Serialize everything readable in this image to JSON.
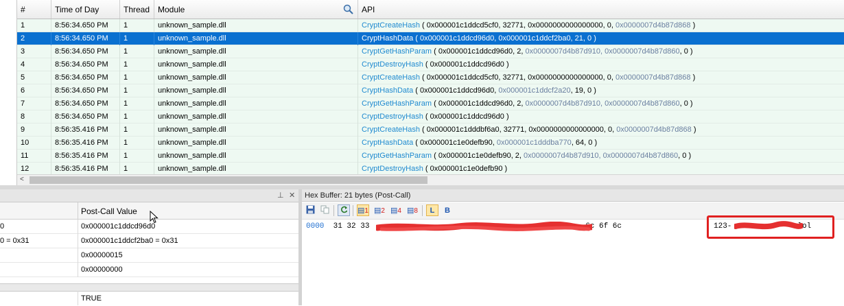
{
  "grid": {
    "columns": [
      "#",
      "Time of Day",
      "Thread",
      "Module",
      "API"
    ],
    "rows": [
      {
        "n": "1",
        "time": "8:56:34.650 PM",
        "thread": "1",
        "module": "unknown_sample.dll",
        "fn": "CryptCreateHash",
        "pre": " ( 0x000001c1ddcd5cf0, 32771, 0x0000000000000000, 0, ",
        "ptr": "0x0000007d4b87d868",
        "post": " )"
      },
      {
        "n": "2",
        "time": "8:56:34.650 PM",
        "thread": "1",
        "module": "unknown_sample.dll",
        "fn": "CryptHashData",
        "pre": " ( 0x000001c1ddcd96d0, 0x000001c1ddcf2ba0, 21, 0 )",
        "ptr": "",
        "post": ""
      },
      {
        "n": "3",
        "time": "8:56:34.650 PM",
        "thread": "1",
        "module": "unknown_sample.dll",
        "fn": "CryptGetHashParam",
        "pre": " ( 0x000001c1ddcd96d0, 2, ",
        "ptr": "0x0000007d4b87d910, 0x0000007d4b87d860",
        "post": ", 0 )"
      },
      {
        "n": "4",
        "time": "8:56:34.650 PM",
        "thread": "1",
        "module": "unknown_sample.dll",
        "fn": "CryptDestroyHash",
        "pre": " ( 0x000001c1ddcd96d0 )",
        "ptr": "",
        "post": ""
      },
      {
        "n": "5",
        "time": "8:56:34.650 PM",
        "thread": "1",
        "module": "unknown_sample.dll",
        "fn": "CryptCreateHash",
        "pre": " ( 0x000001c1ddcd5cf0, 32771, 0x0000000000000000, 0, ",
        "ptr": "0x0000007d4b87d868",
        "post": " )"
      },
      {
        "n": "6",
        "time": "8:56:34.650 PM",
        "thread": "1",
        "module": "unknown_sample.dll",
        "fn": "CryptHashData",
        "pre": " ( 0x000001c1ddcd96d0, ",
        "ptr": "0x000001c1ddcf2a20",
        "post": ", 19, 0 )"
      },
      {
        "n": "7",
        "time": "8:56:34.650 PM",
        "thread": "1",
        "module": "unknown_sample.dll",
        "fn": "CryptGetHashParam",
        "pre": " ( 0x000001c1ddcd96d0, 2, ",
        "ptr": "0x0000007d4b87d910, 0x0000007d4b87d860",
        "post": ", 0 )"
      },
      {
        "n": "8",
        "time": "8:56:34.650 PM",
        "thread": "1",
        "module": "unknown_sample.dll",
        "fn": "CryptDestroyHash",
        "pre": " ( 0x000001c1ddcd96d0 )",
        "ptr": "",
        "post": ""
      },
      {
        "n": "9",
        "time": "8:56:35.416 PM",
        "thread": "1",
        "module": "unknown_sample.dll",
        "fn": "CryptCreateHash",
        "pre": " ( 0x000001c1dddbf6a0, 32771, 0x0000000000000000, 0, ",
        "ptr": "0x0000007d4b87d868",
        "post": " )"
      },
      {
        "n": "10",
        "time": "8:56:35.416 PM",
        "thread": "1",
        "module": "unknown_sample.dll",
        "fn": "CryptHashData",
        "pre": " ( 0x000001c1e0defb90, ",
        "ptr": "0x000001c1dddba770",
        "post": ", 64, 0 )"
      },
      {
        "n": "11",
        "time": "8:56:35.416 PM",
        "thread": "1",
        "module": "unknown_sample.dll",
        "fn": "CryptGetHashParam",
        "pre": " ( 0x000001c1e0defb90, 2, ",
        "ptr": "0x0000007d4b87d910, 0x0000007d4b87d860",
        "post": ", 0 )"
      },
      {
        "n": "12",
        "time": "8:56:35.416 PM",
        "thread": "1",
        "module": "unknown_sample.dll",
        "fn": "CryptDestroyHash",
        "pre": " ( 0x000001c1e0defb90 )",
        "ptr": "",
        "post": ""
      }
    ]
  },
  "params": {
    "header": "Post-Call Value",
    "rows": [
      {
        "left": "0",
        "right": "0x000001c1ddcd96d0"
      },
      {
        "left": "0 = 0x31",
        "right": "0x000001c1ddcf2ba0 = 0x31"
      },
      {
        "left": "",
        "right": "0x00000015"
      },
      {
        "left": "",
        "right": "0x00000000"
      }
    ],
    "return_value": "TRUE"
  },
  "hex": {
    "title": "Hex Buffer: 21 bytes (Post-Call)",
    "offset": "0000",
    "bytes_start": "31 32 33",
    "bytes_end": "6c 6f 6c",
    "ascii_start": "123-",
    "ascii_end": "lol",
    "toolbar": {
      "b1": "1",
      "b2": "2",
      "b4": "4",
      "b8": "8"
    }
  },
  "colors": {
    "selection": "#0a70d0",
    "api_fn": "#1f8ad0",
    "row_bg": "#eef9f2",
    "highlight_box": "#e02020"
  }
}
